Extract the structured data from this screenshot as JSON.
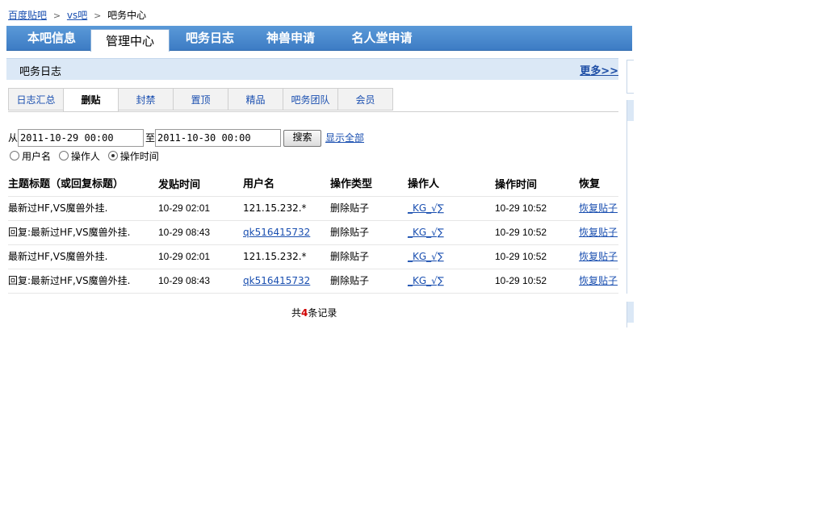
{
  "breadcrumb": {
    "home": "百度贴吧",
    "forum": "vs吧",
    "current": "吧务中心"
  },
  "main_nav": [
    {
      "label": "本吧信息"
    },
    {
      "label": "管理中心"
    },
    {
      "label": "吧务日志"
    },
    {
      "label": "神兽申请"
    },
    {
      "label": "名人堂申请"
    }
  ],
  "section": {
    "title": "吧务日志",
    "more": "更多>>"
  },
  "sub_tabs": [
    "日志汇总",
    "删贴",
    "封禁",
    "置顶",
    "精品",
    "吧务团队",
    "会员"
  ],
  "search": {
    "from_label": "从",
    "from_value": "2011-10-29 00:00",
    "to_label": "至",
    "to_value": "2011-10-30 00:00",
    "button": "搜索",
    "show_all": "显示全部"
  },
  "sort_options": [
    {
      "label": "用户名",
      "checked": false
    },
    {
      "label": "操作人",
      "checked": false
    },
    {
      "label": "操作时间",
      "checked": true
    }
  ],
  "table": {
    "headers": [
      "主题标题（或回复标题）",
      "发贴时间",
      "用户名",
      "操作类型",
      "操作人",
      "操作时间",
      "恢复"
    ],
    "rows": [
      {
        "title": "最新过HF,VS魔兽外挂.",
        "post_time": "10-29 02:01",
        "user": "121.15.232.*",
        "user_link": false,
        "action": "删除贴子",
        "operator": "_KG_√∑",
        "op_time": "10-29 10:52",
        "restore": "恢复贴子"
      },
      {
        "title": "回复:最新过HF,VS魔兽外挂.",
        "post_time": "10-29 08:43",
        "user": "qk516415732",
        "user_link": true,
        "action": "删除贴子",
        "operator": "_KG_√∑",
        "op_time": "10-29 10:52",
        "restore": "恢复贴子"
      },
      {
        "title": "最新过HF,VS魔兽外挂.",
        "post_time": "10-29 02:01",
        "user": "121.15.232.*",
        "user_link": false,
        "action": "删除贴子",
        "operator": "_KG_√∑",
        "op_time": "10-29 10:52",
        "restore": "恢复贴子"
      },
      {
        "title": "回复:最新过HF,VS魔兽外挂.",
        "post_time": "10-29 08:43",
        "user": "qk516415732",
        "user_link": true,
        "action": "删除贴子",
        "operator": "_KG_√∑",
        "op_time": "10-29 10:52",
        "restore": "恢复贴子"
      }
    ]
  },
  "pager": {
    "prefix": "共",
    "count": "4",
    "suffix": "条记录"
  }
}
